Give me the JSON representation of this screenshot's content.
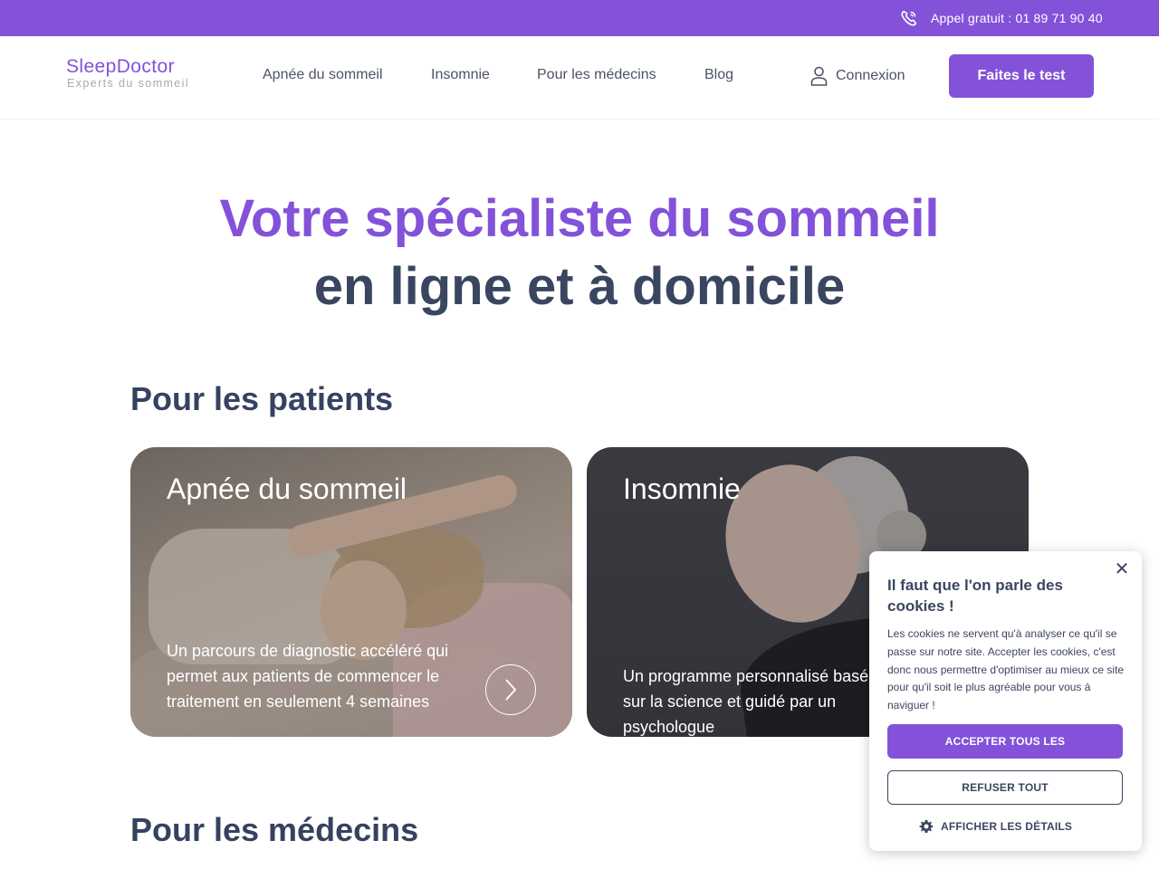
{
  "topbar": {
    "call_text": "Appel gratuit : 01 89 71 90 40",
    "icon": "phone-icon"
  },
  "header": {
    "logo_main": "SleepDoctor",
    "logo_sub": "Experts du sommeil",
    "nav": [
      "Apnée du sommeil",
      "Insomnie",
      "Pour les médecins",
      "Blog"
    ],
    "login_label": "Connexion",
    "login_icon": "user-icon",
    "cta_label": "Faites le test"
  },
  "hero": {
    "line1": "Votre spécialiste du sommeil",
    "line2": "en ligne et à domicile"
  },
  "sections": {
    "patients_title": "Pour les patients",
    "medecins_title": "Pour les médecins"
  },
  "cards": [
    {
      "title": "Apnée du sommeil",
      "text": "Un parcours de diagnostic accéléré qui permet aux patients de commencer le traitement en seulement 4 semaines",
      "icon": "chevron-right-icon"
    },
    {
      "title": "Insomnie",
      "text": "Un programme personnalisé basé sur la science et guidé par un psychologue"
    }
  ],
  "cookie": {
    "title": "Il faut que l'on parle des cookies !",
    "body": "Les cookies ne servent qu'à analyser ce qu'il se passe sur notre site. Accepter les cookies, c'est donc nous permettre d'optimiser au mieux ce site pour qu'il soit le plus agréable pour vous à naviguer !",
    "accept_label": "ACCEPTER TOUS LES",
    "refuse_label": "REFUSER TOUT",
    "details_label": "AFFICHER LES DÉTAILS",
    "close_glyph": "✕"
  },
  "colors": {
    "brand": "#8352d9",
    "text": "#364260"
  }
}
